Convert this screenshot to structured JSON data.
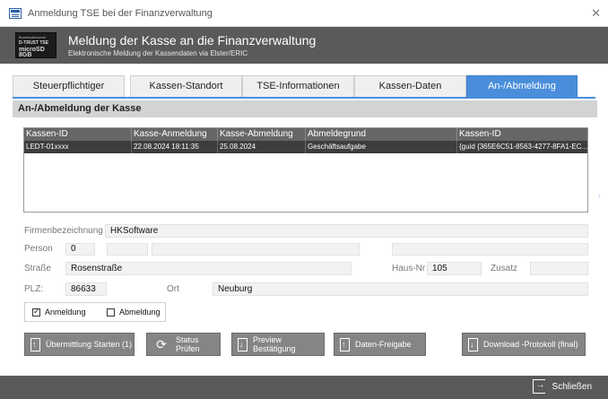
{
  "window": {
    "title": "Anmeldung TSE bei der Finanzverwaltung"
  },
  "header": {
    "logo_line1": "Bundesdruckerei",
    "logo_line2": "D-TRUST TSE",
    "logo_line3": "microSD 8GB",
    "title": "Meldung der Kasse an die Finanzverwaltung",
    "subtitle": "Elektronische Meldung der Kassendaten via Elster/ERIC"
  },
  "tabs": [
    {
      "label": "Steuerpflichtiger",
      "active": false
    },
    {
      "label": "Kassen-Standort",
      "active": false
    },
    {
      "label": "TSE-Informationen",
      "active": false
    },
    {
      "label": "Kassen-Daten",
      "active": false
    },
    {
      "label": "An-/Abmeldung",
      "active": true
    }
  ],
  "section": {
    "title": "An-/Abmeldung der Kasse"
  },
  "table": {
    "columns": [
      "Kassen-ID",
      "Kasse-Anmeldung",
      "Kasse-Abmeldung",
      "Abmeldegrund",
      "Kassen-ID"
    ],
    "rows": [
      [
        "LEDT-01xxxx",
        "22.08.2024 18:11:35",
        "25.08.2024",
        "Geschäftsaufgabe",
        "{guid {365E6C51-8563-4277-8FA1-EC..."
      ]
    ]
  },
  "form": {
    "firma_label": "Firmenbezeichnung",
    "firma_value": "HKSoftware",
    "person_label": "Person",
    "person_value": "0",
    "person_field2": "",
    "person_field3": "",
    "person_field4": "",
    "strasse_label": "Straße",
    "strasse_value": "Rosenstraße",
    "hausnr_label": "Haus-Nr",
    "hausnr_value": "105",
    "zusatz_label": "Zusatz",
    "zusatz_value": "",
    "plz_label": "PLZ:",
    "plz_value": "86633",
    "ort_label": "Ort",
    "ort_value": "Neuburg"
  },
  "checks": {
    "anmeldung_label": "Anmeldung",
    "anmeldung_checked": true,
    "abmeldung_label": "Abmeldung",
    "abmeldung_checked": false
  },
  "buttons": {
    "start": "Übermittlung Starten (1)",
    "status": "Status Prüfen",
    "preview": "Preview Bestätigung",
    "freigabe": "Daten-Freigabe",
    "download": "Download -Protokoll (final)"
  },
  "footer": {
    "close_label": "Schließen"
  },
  "colors": {
    "accent": "#4a8edb",
    "header_bg": "#5a5a5a",
    "button_bg": "#858585"
  }
}
